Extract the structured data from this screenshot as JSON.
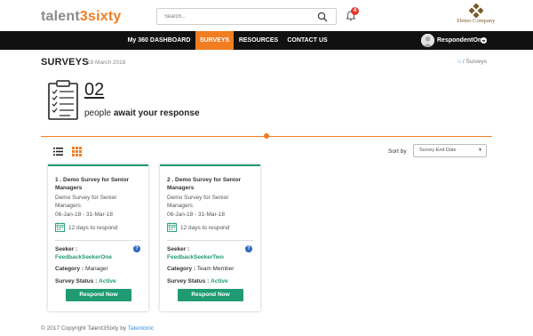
{
  "header": {
    "logo_main": "talent",
    "logo_accent": "3",
    "logo_tail": "sixty",
    "search_placeholder": "Search...",
    "notification_count": "4",
    "company_name": "Demo Company"
  },
  "nav": {
    "items": [
      {
        "label": "My 360 DASHBOARD",
        "active": false
      },
      {
        "label": "SURVEYS",
        "active": true
      },
      {
        "label": "RESOURCES",
        "active": false
      },
      {
        "label": "CONTACT US",
        "active": false
      }
    ],
    "user_name": "RespondentOne"
  },
  "page": {
    "title": "SURVEYS",
    "date": "19 March 2018",
    "breadcrumb_current": "Surveys",
    "breadcrumb_sep": "/",
    "pending_count": "02",
    "await_prefix": "people",
    "await_bold": "await your response",
    "sort_label": "Sort by",
    "sort_value": "Survey End Date"
  },
  "cards": [
    {
      "title": "1 . Demo Survey for Senior Managers",
      "subtitle": "Demo Survey for Senior Managers",
      "dates": "06-Jan-18 - 31-Mar-18",
      "days": "12 days to respond",
      "seeker_label": "Seeker :",
      "seeker_name": "FeedbackSeekerOne",
      "category_label": "Category :",
      "category_value": "Manager",
      "status_label": "Survey Status :",
      "status_value": "Active",
      "button": "Respond Now"
    },
    {
      "title": "2 . Demo Survey for Senior Managers",
      "subtitle": "Demo Survey for Senior Managers",
      "dates": "06-Jan-18 - 31-Mar-18",
      "days": "12 days to respond",
      "seeker_label": "Seeker :",
      "seeker_name": "FeedbackSeekerTwo",
      "category_label": "Category :",
      "category_value": "Team Member",
      "status_label": "Survey Status :",
      "status_value": "Active",
      "button": "Respond Now"
    }
  ],
  "footer": {
    "text": "© 2017 Copyright Talent3Sixty by",
    "link": "Talentonic"
  },
  "colors": {
    "brand_orange": "#f07d22",
    "accent_green": "#1f9a73",
    "nav_black": "#111111"
  }
}
